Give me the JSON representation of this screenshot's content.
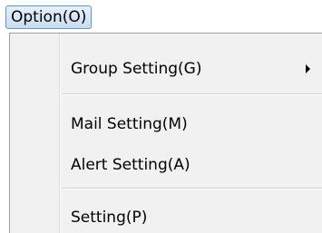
{
  "menubar": {
    "title": "Option(O)"
  },
  "menu": {
    "items": [
      {
        "label": "Group Setting(G)",
        "has_submenu": true
      },
      {
        "label": "Mail Setting(M)"
      },
      {
        "label": "Alert Setting(A)"
      },
      {
        "label": "Setting(P)"
      }
    ]
  }
}
